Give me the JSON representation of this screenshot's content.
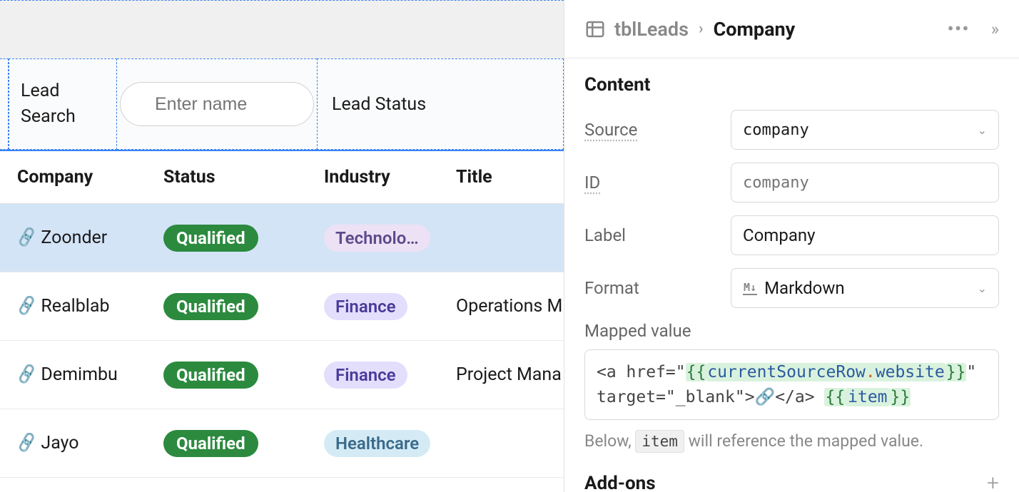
{
  "filter": {
    "lead_search_label": "Lead Search",
    "search_placeholder": "Enter name",
    "lead_status_label": "Lead Status"
  },
  "table": {
    "headers": {
      "company": "Company",
      "status": "Status",
      "industry": "Industry",
      "title": "Title"
    },
    "rows": [
      {
        "company": "Zoonder",
        "status": "Qualified",
        "industry": "Technolo…",
        "industry_class": "ind-tech",
        "title": "",
        "selected": true
      },
      {
        "company": "Realblab",
        "status": "Qualified",
        "industry": "Finance",
        "industry_class": "ind-fin",
        "title": "Operations M"
      },
      {
        "company": "Demimbu",
        "status": "Qualified",
        "industry": "Finance",
        "industry_class": "ind-fin",
        "title": "Project Mana"
      },
      {
        "company": "Jayo",
        "status": "Qualified",
        "industry": "Healthcare",
        "industry_class": "ind-health",
        "title": ""
      }
    ]
  },
  "panel": {
    "breadcrumb_table": "tblLeads",
    "breadcrumb_field": "Company",
    "section_content": "Content",
    "labels": {
      "source": "Source",
      "id": "ID",
      "label": "Label",
      "format": "Format",
      "mapped_value": "Mapped value",
      "addons": "Add-ons"
    },
    "values": {
      "source": "company",
      "id_placeholder": "company",
      "label": "Company",
      "format": "Markdown"
    },
    "code": {
      "prefix": "<a href=\"",
      "brace_open": "{{",
      "obj": "currentSourceRow",
      "dot": ".",
      "prop": "website",
      "brace_close": "}}",
      "mid": "\" target=\"_blank\">🔗</a> ",
      "item_open": "{{",
      "item": "item",
      "item_close": "}}"
    },
    "hint_before": "Below, ",
    "hint_code": "item",
    "hint_after": " will reference the mapped value."
  }
}
